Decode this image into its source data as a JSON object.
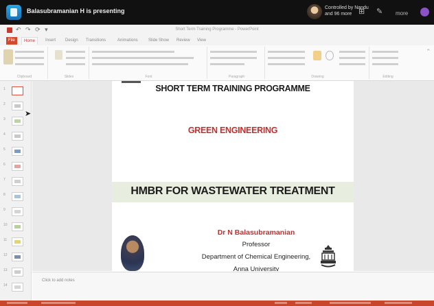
{
  "window": {
    "title": "Balasubramanian H is presenting",
    "presenter": "Controlled by Nandu\nand 96 more",
    "more_label": "more",
    "qat_title": "Short Term Training Programme - PowerPoint"
  },
  "ribbon": {
    "tabs": [
      "File",
      "Home",
      "Insert",
      "Design",
      "Transitions",
      "Animations",
      "Slide Show",
      "Review",
      "View"
    ],
    "groups": [
      "Clipboard",
      "Slides",
      "Font",
      "Paragraph",
      "Drawing",
      "Editing"
    ]
  },
  "slide": {
    "heading": "SHORT TERM TRAINING PROGRAMME",
    "subheading": "GREEN ENGINEERING",
    "main_title": "HMBR FOR WASTEWATER TREATMENT",
    "presenter_name": "Dr N Balasubramanian",
    "presenter_role": "Professor",
    "presenter_dept": "Department of Chemical Engineering,",
    "presenter_org": "Anna University"
  },
  "thumbnails": [
    "1",
    "2",
    "3",
    "4",
    "5",
    "6",
    "7",
    "8",
    "9",
    "10",
    "11",
    "12",
    "13",
    "14"
  ],
  "notes": {
    "placeholder": "Click to add notes"
  },
  "colors": {
    "accent": "#c8392f",
    "slide_red": "#c62d2d",
    "band": "#e8eedf",
    "statusbar": "#c8462c"
  }
}
